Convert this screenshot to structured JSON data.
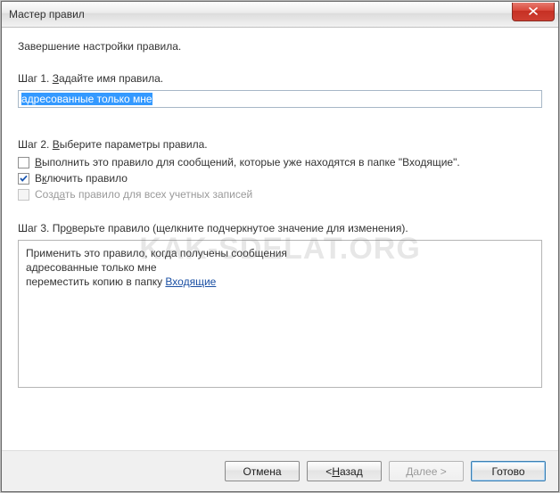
{
  "window": {
    "title": "Мастер правил",
    "subtitle": "Завершение настройки правила."
  },
  "step1": {
    "prefix": "Шаг 1. ",
    "ukey": "З",
    "rest": "адайте имя правила.",
    "value": "адресованные только мне"
  },
  "step2": {
    "prefix": "Шаг 2. ",
    "ukey": "В",
    "rest": "ыберите параметры правила.",
    "opt1_ukey": "В",
    "opt1_rest": "ыполнить это правило для сообщений, которые уже находятся в папке \"Входящие\".",
    "opt2_pre": "В",
    "opt2_ukey": "к",
    "opt2_rest": "лючить правило",
    "opt3_pre": "Созд",
    "opt3_ukey": "а",
    "opt3_rest": "ть правило для всех учетных записей"
  },
  "step3": {
    "prefix": "Шаг 3. ",
    "text1": "Пр",
    "ukey": "о",
    "text2": "верьте правило (щелкните подчеркнутое значение для изменения).",
    "line1": "Применить это правило, когда получены сообщения",
    "line2": "адресованные только мне",
    "line3a": "переместить копию в папку ",
    "line3b": "Входящие"
  },
  "footer": {
    "cancel": "Отмена",
    "back_pre": "< ",
    "back_u": "Н",
    "back_post": "азад",
    "next_u": "Д",
    "next_post": "алее >",
    "finish": "Готово"
  },
  "watermark": "KAK-SDELAT.ORG"
}
